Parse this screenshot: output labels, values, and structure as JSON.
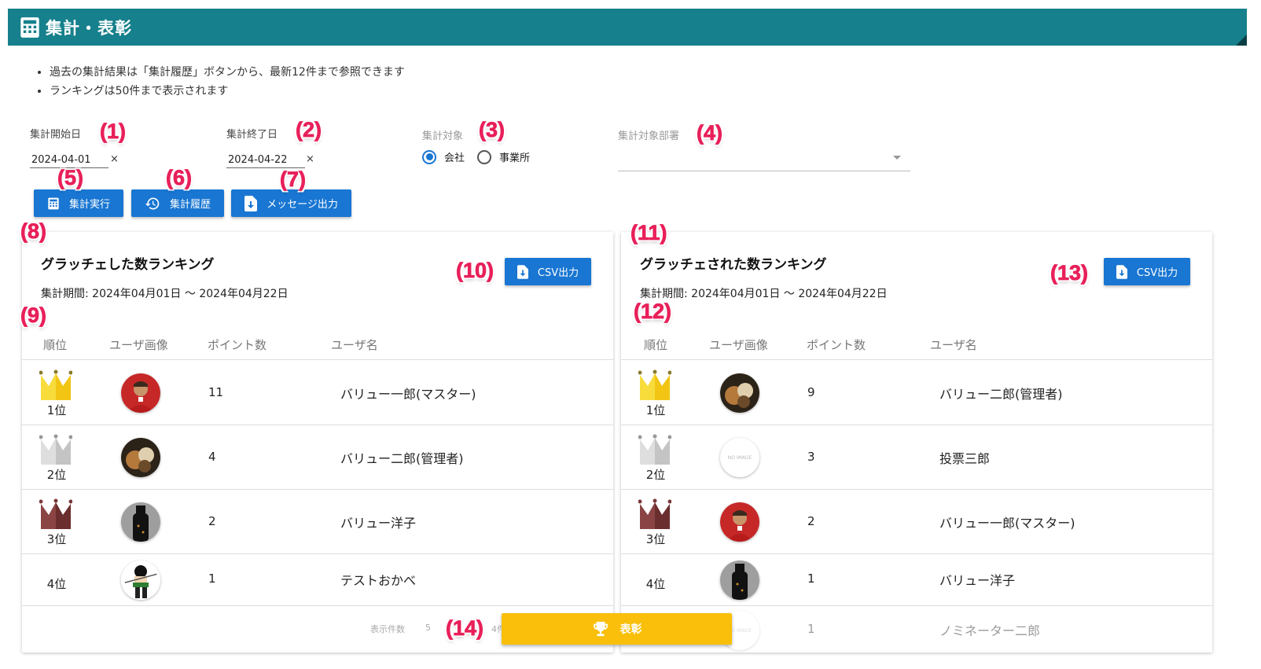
{
  "header": {
    "title": "集計・表彰"
  },
  "notes": [
    "過去の集計結果は「集計履歴」ボタンから、最新12件まで参照できます",
    "ランキングは50件まで表示されます"
  ],
  "form": {
    "start_label": "集計開始日",
    "start_value": "2024-04-01",
    "end_label": "集計終了日",
    "end_value": "2024-04-22",
    "clear": "×",
    "target_label": "集計対象",
    "target_options": [
      "会社",
      "事業所"
    ],
    "target_selected": "会社",
    "dept_label": "集計対象部署",
    "dept_value": ""
  },
  "buttons": {
    "run": "集計実行",
    "history": "集計履歴",
    "message": "メッセージ出力",
    "csv": "CSV出力",
    "award": "表彰"
  },
  "columns": [
    "順位",
    "ユーザ画像",
    "ポイント数",
    "ユーザ名"
  ],
  "left": {
    "title": "グラッチェした数ランキング",
    "period": "集計期間: 2024年04月01日 〜 2024年04月22日",
    "rows": [
      {
        "rank": "1位",
        "points": "11",
        "name": "バリュー一郎(マスター)",
        "avatar": "player-photo"
      },
      {
        "rank": "2位",
        "points": "4",
        "name": "バリュー二郎(管理者)",
        "avatar": "food-photo"
      },
      {
        "rank": "3位",
        "points": "2",
        "name": "バリュー洋子",
        "avatar": "bottle-photo"
      },
      {
        "rank": "4位",
        "points": "1",
        "name": "テストおかべ",
        "avatar": "cartoon-photo"
      }
    ],
    "footer": {
      "per_page_label": "表示件数",
      "per_page": "5",
      "range": "4件"
    }
  },
  "right": {
    "title": "グラッチェされた数ランキング",
    "period": "集計期間: 2024年04月01日 〜 2024年04月22日",
    "rows": [
      {
        "rank": "1位",
        "points": "9",
        "name": "バリュー二郎(管理者)",
        "avatar": "food-photo"
      },
      {
        "rank": "2位",
        "points": "3",
        "name": "投票三郎",
        "avatar": "no-image"
      },
      {
        "rank": "3位",
        "points": "2",
        "name": "バリュー一郎(マスター)",
        "avatar": "player-photo"
      },
      {
        "rank": "4位",
        "points": "1",
        "name": "バリュー洋子",
        "avatar": "bottle-photo"
      },
      {
        "rank": "",
        "points": "1",
        "name": "ノミネーター二郎",
        "avatar": "no-image"
      }
    ],
    "noimage": "NO IMAGE"
  },
  "badges": [
    "(1)",
    "(2)",
    "(3)",
    "(4)",
    "(5)",
    "(6)",
    "(7)",
    "(8)",
    "(9)",
    "(10)",
    "(11)",
    "(12)",
    "(13)",
    "(14)"
  ],
  "colors": {
    "header_bg": "#16808c",
    "primary": "#1976d2",
    "award": "#f9bf0a",
    "badge": "#e8205a",
    "gold": "#f7dc3c",
    "silver": "#d0d0d0",
    "bronze": "#7a3838"
  }
}
